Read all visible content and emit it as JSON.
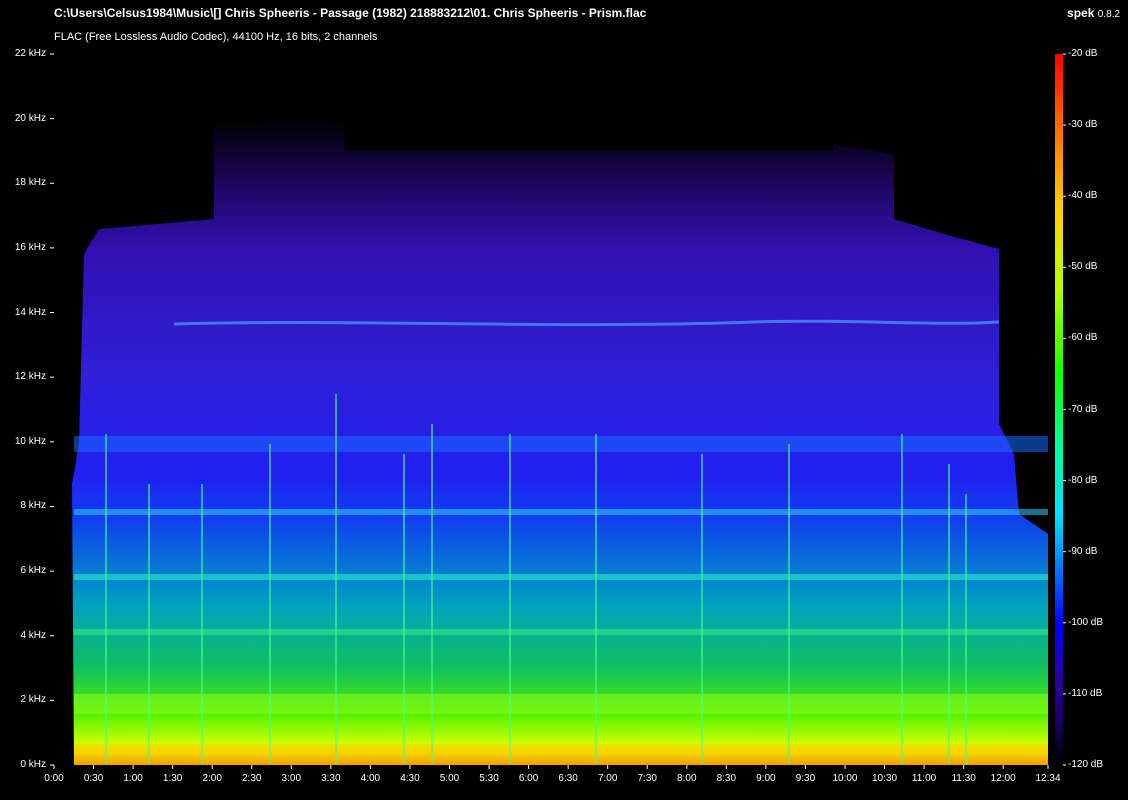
{
  "app": {
    "name": "spek",
    "version": "0.8.2"
  },
  "file": {
    "path": "C:\\Users\\Celsus1984\\Music\\[] Chris Spheeris - Passage (1982) 218883212\\01. Chris Spheeris - Prism.flac",
    "format": "FLAC (Free Lossless Audio Codec), 44100 Hz, 16 bits, 2 channels"
  },
  "axes": {
    "freq_labels": [
      "22 kHz",
      "20 kHz",
      "18 kHz",
      "16 kHz",
      "14 kHz",
      "12 kHz",
      "10 kHz",
      "8 kHz",
      "6 kHz",
      "4 kHz",
      "2 kHz",
      "0 kHz"
    ],
    "time_labels": [
      "0:00",
      "0:30",
      "1:00",
      "1:30",
      "2:00",
      "2:30",
      "3:00",
      "3:30",
      "4:00",
      "4:30",
      "5:00",
      "5:30",
      "6:00",
      "6:30",
      "7:00",
      "7:30",
      "8:00",
      "8:30",
      "9:00",
      "9:30",
      "10:00",
      "10:30",
      "11:00",
      "11:30",
      "12:00",
      "12:34"
    ],
    "db_labels": [
      "-20 dB",
      "-30 dB",
      "-40 dB",
      "-50 dB",
      "-60 dB",
      "-70 dB",
      "-80 dB",
      "-90 dB",
      "-100 dB",
      "-110 dB",
      "-120 dB"
    ]
  },
  "colors": {
    "background": "#000000",
    "text": "#ffffff"
  },
  "icons": [
    "spectrogram-image",
    "color-scale-bar"
  ]
}
